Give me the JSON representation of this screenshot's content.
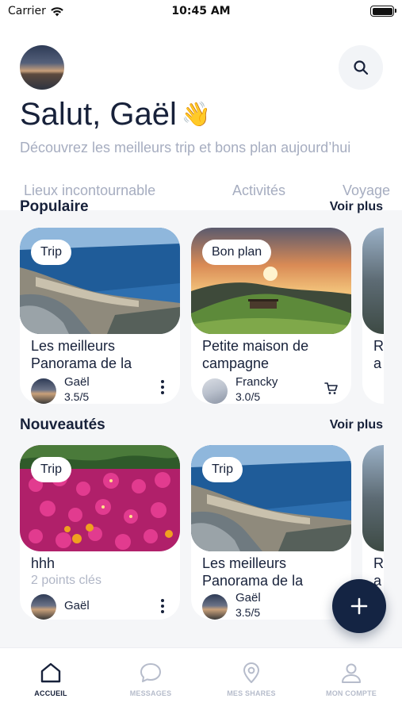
{
  "status_bar": {
    "carrier": "Carrier",
    "time": "10:45 AM"
  },
  "header": {
    "greeting": "Salut, Gaël",
    "wave_emoji": "👋",
    "subtitle": "Découvrez les meilleurs trip et bons plan aujourd’hui",
    "tabs": [
      "Lieux incontournable",
      "Activités",
      "Voyage"
    ]
  },
  "popular": {
    "title": "Populaire",
    "see_more": "Voir plus",
    "cards": [
      {
        "badge": "Trip",
        "title": "Les meilleurs Panorama de la",
        "author": "Gaël",
        "rating": "3.5/5",
        "image_icon": "coastal-city-photo",
        "action_icon": "more-vertical-icon"
      },
      {
        "badge": "Bon plan",
        "title": "Petite maison de campagne",
        "author": "Francky",
        "rating": "3.0/5",
        "image_icon": "sunset-hill-photo",
        "action_icon": "cart-icon"
      }
    ],
    "partial_card_title": "R a"
  },
  "new": {
    "title": "Nouveautés",
    "see_more": "Voir plus",
    "cards": [
      {
        "badge": "Trip",
        "title": "hhh",
        "subtitle": "2 points clés",
        "author": "Gaël",
        "image_icon": "flowers-photo",
        "action_icon": "more-vertical-icon"
      },
      {
        "badge": "Trip",
        "title": "Les meilleurs Panorama de la",
        "author": "Gaël",
        "rating": "3.5/5",
        "image_icon": "coastal-city-photo",
        "action_icon": "more-vertical-icon"
      }
    ],
    "partial_card_title": "R a"
  },
  "fab": {
    "icon": "plus-icon"
  },
  "tabbar": {
    "items": [
      {
        "label": "ACCUEIL",
        "icon": "home-icon",
        "active": true
      },
      {
        "label": "MESSAGES",
        "icon": "chat-bubble-icon",
        "active": false
      },
      {
        "label": "MES SHARES",
        "icon": "map-pin-icon",
        "active": false
      },
      {
        "label": "MON COMPTE",
        "icon": "user-icon",
        "active": false
      }
    ]
  },
  "colors": {
    "primary": "#142443",
    "muted": "#a6adc0",
    "background": "#f5f6f8"
  }
}
